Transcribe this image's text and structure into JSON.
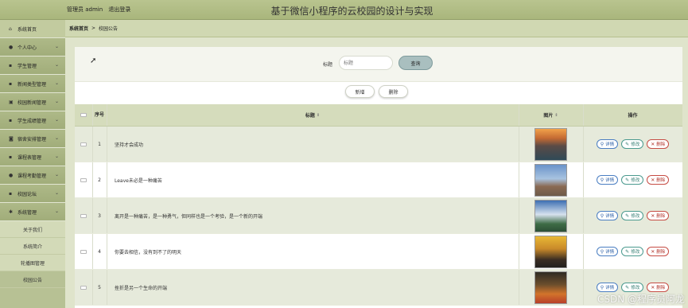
{
  "header": {
    "user_label": "管理员 admin",
    "logout_label": "退出登录",
    "title": "基于微信小程序的云校园的设计与实现"
  },
  "sidebar": {
    "items": [
      {
        "label": "系统首页",
        "icon": "home-icon"
      },
      {
        "label": "个人中心",
        "icon": "user-icon"
      },
      {
        "label": "学生管理",
        "icon": "grid-icon"
      },
      {
        "label": "新闻类型管理",
        "icon": "grid-icon"
      },
      {
        "label": "校园新闻管理",
        "icon": "lock-icon"
      },
      {
        "label": "学生成绩管理",
        "icon": "grid-icon"
      },
      {
        "label": "宿舍安排管理",
        "icon": "truck-icon"
      },
      {
        "label": "课程表管理",
        "icon": "grid-icon"
      },
      {
        "label": "课程考勤管理",
        "icon": "user-icon"
      },
      {
        "label": "校园论坛",
        "icon": "grid-icon"
      },
      {
        "label": "系统管理",
        "icon": "settings-icon"
      }
    ],
    "sub_items": [
      "关于我们",
      "系统简介",
      "轮播图管理",
      "校园公告"
    ]
  },
  "breadcrumb": {
    "home": "系统首页",
    "separator": ">",
    "current": "校园公告"
  },
  "search": {
    "label": "标题",
    "placeholder": "标题",
    "button": "查询"
  },
  "toolbar": {
    "add": "新增",
    "delete": "删除"
  },
  "table": {
    "headers": {
      "no": "序号",
      "title": "标题",
      "image": "图片",
      "actions": "操作"
    },
    "rows": [
      {
        "no": "1",
        "title": "坚持才会成功"
      },
      {
        "no": "2",
        "title": "Leave未必是一种痛苦"
      },
      {
        "no": "3",
        "title": "离开是一种痛苦，是一种勇气，但同样也是一个考验，是一个新的开端"
      },
      {
        "no": "4",
        "title": "你要去相信，没有到不了的明天"
      },
      {
        "no": "5",
        "title": "挫折是另一个生命的开端"
      }
    ],
    "action_labels": {
      "detail": "详情",
      "edit": "修改",
      "delete": "删除"
    }
  },
  "watermark": "CSDN @程序员阿龙",
  "colors": {
    "accent": "#a9b67c",
    "detail": "#4a7ec2",
    "edit": "#4b9a8f",
    "delete": "#c64c44"
  }
}
